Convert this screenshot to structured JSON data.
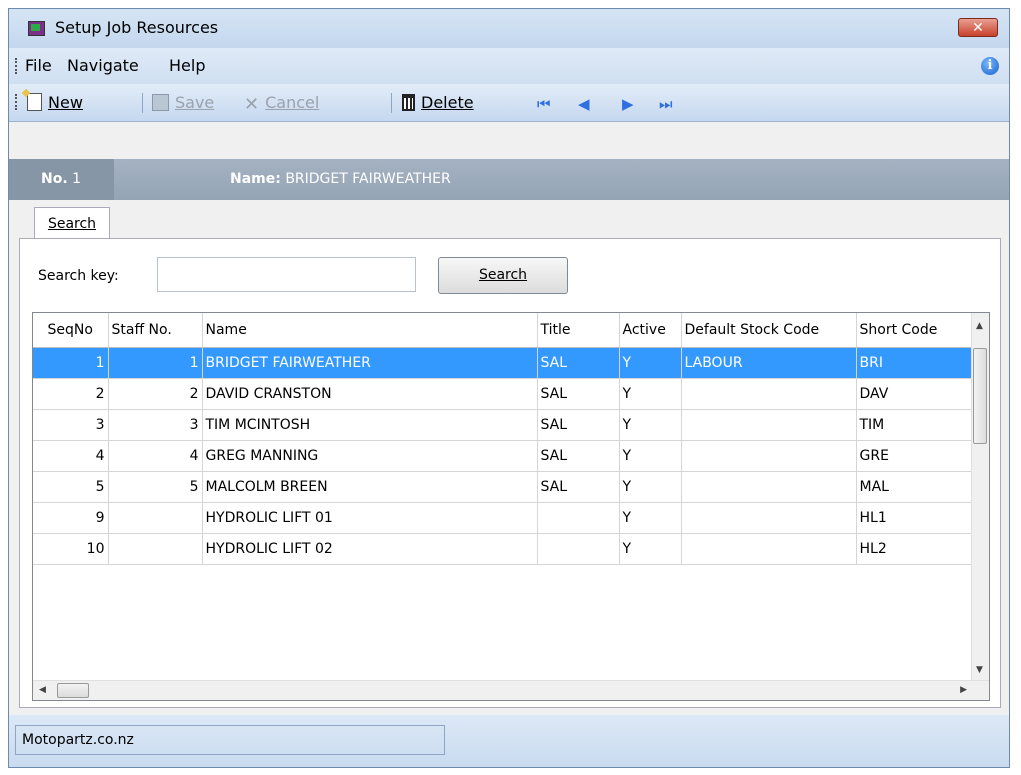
{
  "window": {
    "title": "Setup Job Resources",
    "close_label": "✕"
  },
  "menu": {
    "items": [
      "File",
      "Navigate",
      "Help"
    ]
  },
  "toolbar": {
    "new_label": "New",
    "save_label": "Save",
    "cancel_label": "Cancel",
    "delete_label": "Delete",
    "nav": {
      "first": "⏮",
      "prev": "◀",
      "next": "▶",
      "last": "⏭"
    }
  },
  "record": {
    "no_label": "No.",
    "no_value": "1",
    "name_label": "Name:",
    "name_value": "BRIDGET FAIRWEATHER"
  },
  "tabs": {
    "search": "Search"
  },
  "search": {
    "key_label": "Search key:",
    "input_value": "",
    "button_label": "Search"
  },
  "grid": {
    "columns": [
      "SeqNo",
      "Staff No.",
      "Name",
      "Title",
      "Active",
      "Default Stock Code",
      "Short Code"
    ],
    "rows": [
      {
        "seq": "1",
        "staff": "1",
        "name": "BRIDGET FAIRWEATHER",
        "title": "SAL",
        "active": "Y",
        "stock": "LABOUR",
        "short": "BRI",
        "selected": true
      },
      {
        "seq": "2",
        "staff": "2",
        "name": "DAVID CRANSTON",
        "title": "SAL",
        "active": "Y",
        "stock": "",
        "short": "DAV"
      },
      {
        "seq": "3",
        "staff": "3",
        "name": "TIM MCINTOSH",
        "title": "SAL",
        "active": "Y",
        "stock": "",
        "short": "TIM"
      },
      {
        "seq": "4",
        "staff": "4",
        "name": "GREG MANNING",
        "title": "SAL",
        "active": "Y",
        "stock": "",
        "short": "GRE"
      },
      {
        "seq": "5",
        "staff": "5",
        "name": "MALCOLM BREEN",
        "title": "SAL",
        "active": "Y",
        "stock": "",
        "short": "MAL"
      },
      {
        "seq": "9",
        "staff": "",
        "name": "HYDROLIC LIFT 01",
        "title": "",
        "active": "Y",
        "stock": "",
        "short": "HL1"
      },
      {
        "seq": "10",
        "staff": "",
        "name": "HYDROLIC LIFT 02",
        "title": "",
        "active": "Y",
        "stock": "",
        "short": "HL2"
      }
    ]
  },
  "status": {
    "text": "Motopartz.co.nz"
  },
  "colors": {
    "selection": "#3399ff",
    "band": "#9aa8b8",
    "toolbar": "#c5d8ef"
  },
  "icons": [
    "app-icon",
    "close-icon",
    "info-icon",
    "new-icon",
    "save-icon",
    "cancel-icon",
    "delete-icon",
    "first-record-icon",
    "prev-record-icon",
    "next-record-icon",
    "last-record-icon"
  ]
}
